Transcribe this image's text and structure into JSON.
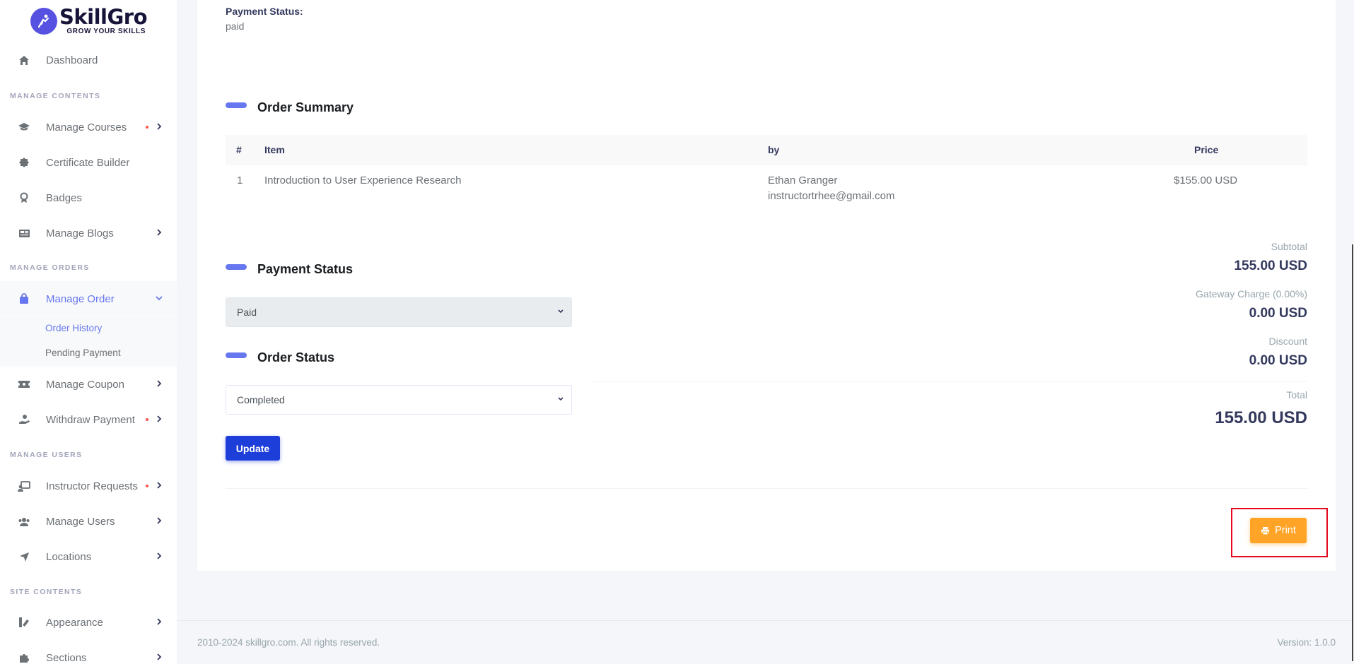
{
  "brand": {
    "name": "SkillGro",
    "tagline": "GROW YOUR SKILLS"
  },
  "sidebar": {
    "dashboard": "Dashboard",
    "headers": {
      "contents": "MANAGE CONTENTS",
      "orders": "MANAGE ORDERS",
      "users": "MANAGE USERS",
      "site": "SITE CONTENTS"
    },
    "items": {
      "courses": "Manage Courses",
      "certificate": "Certificate Builder",
      "badges": "Badges",
      "blogs": "Manage Blogs",
      "order": "Manage Order",
      "order_history": "Order History",
      "pending_payment": "Pending Payment",
      "coupon": "Manage Coupon",
      "withdraw": "Withdraw Payment",
      "instructor_requests": "Instructor Requests",
      "users": "Manage Users",
      "locations": "Locations",
      "appearance": "Appearance",
      "sections": "Sections"
    }
  },
  "order": {
    "payment_status_label": "Payment Status:",
    "payment_status_value": "paid",
    "summary_title": "Order Summary",
    "columns": {
      "num": "#",
      "item": "Item",
      "by": "by",
      "price": "Price"
    },
    "rows": [
      {
        "num": "1",
        "item": "Introduction to User Experience Research",
        "by_name": "Ethan Granger",
        "by_email": "instructortrhee@gmail.com",
        "price": "$155.00 USD"
      }
    ],
    "payment_status_title": "Payment Status",
    "payment_status_selected": "Paid",
    "order_status_title": "Order Status",
    "order_status_selected": "Completed",
    "update_label": "Update",
    "subtotal_label": "Subtotal",
    "subtotal_value": "155.00 USD",
    "gateway_label": "Gateway Charge (0.00%)",
    "gateway_value": "0.00 USD",
    "discount_label": "Discount",
    "discount_value": "0.00 USD",
    "total_label": "Total",
    "total_value": "155.00 USD",
    "print_label": "Print"
  },
  "footer": {
    "copyright": "2010-2024 skillgro.com. All rights reserved.",
    "version": "Version: 1.0.0"
  },
  "colors": {
    "accent": "#6777ef",
    "update_button": "#1e3ed9",
    "print_button": "#ffa426",
    "highlight_frame": "#e3081f"
  }
}
